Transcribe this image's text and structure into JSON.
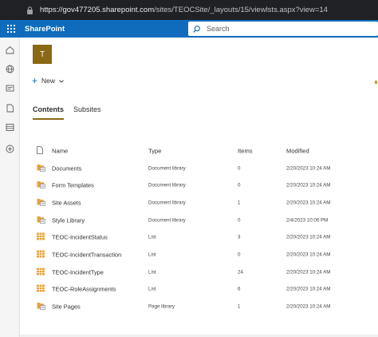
{
  "browser": {
    "url_host": "https://gov477205.sharepoint.com",
    "url_path": "/sites/TEOCSite/_layouts/15/viewlsts.aspx?view=14"
  },
  "suitebar": {
    "title": "SharePoint",
    "search_placeholder": "Search",
    "bg_color": "#0f6cbd"
  },
  "site": {
    "logo_letter": "T",
    "logo_color": "#8b6914"
  },
  "commandbar": {
    "new_label": "New"
  },
  "tabs": [
    {
      "label": "Contents",
      "active": true
    },
    {
      "label": "Subsites",
      "active": false
    }
  ],
  "table": {
    "headers": {
      "name": "Name",
      "type": "Type",
      "items": "Items",
      "modified": "Modified"
    },
    "rows": [
      {
        "icon": "library-icon",
        "name": "Documents",
        "type": "Document library",
        "items": "0",
        "modified": "2/20/2023 10:24 AM"
      },
      {
        "icon": "library-icon",
        "name": "Form Templates",
        "type": "Document library",
        "items": "0",
        "modified": "2/20/2023 10:24 AM"
      },
      {
        "icon": "library-icon",
        "name": "Site Assets",
        "type": "Document library",
        "items": "1",
        "modified": "2/20/2023 10:24 AM"
      },
      {
        "icon": "library-icon",
        "name": "Style Library",
        "type": "Document library",
        "items": "0",
        "modified": "2/4/2023 10:06 PM"
      },
      {
        "icon": "list-icon",
        "name": "TEOC-IncidentStatus",
        "type": "List",
        "items": "3",
        "modified": "2/20/2023 10:24 AM"
      },
      {
        "icon": "list-icon",
        "name": "TEOC-IncidentTransaction",
        "type": "List",
        "items": "0",
        "modified": "2/20/2023 10:24 AM"
      },
      {
        "icon": "list-icon",
        "name": "TEOC-IncidentType",
        "type": "List",
        "items": "24",
        "modified": "2/20/2023 10:24 AM"
      },
      {
        "icon": "list-icon",
        "name": "TEOC-RoleAssignments",
        "type": "List",
        "items": "6",
        "modified": "2/20/2023 10:24 AM"
      },
      {
        "icon": "library-icon",
        "name": "Site Pages",
        "type": "Page library",
        "items": "1",
        "modified": "2/20/2023 10:24 AM"
      }
    ]
  }
}
